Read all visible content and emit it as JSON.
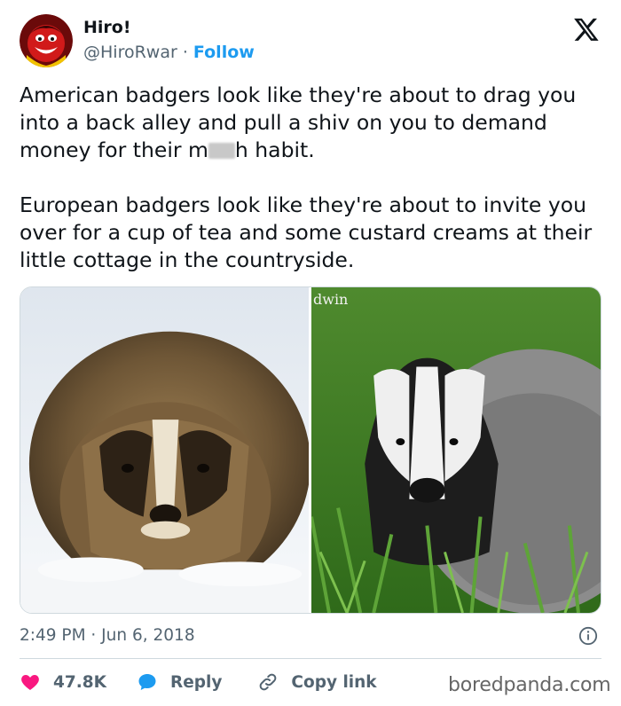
{
  "author": {
    "name": "Hiro!",
    "handle": "@HiroRwar",
    "separator": "·",
    "follow_label": "Follow"
  },
  "tweet": {
    "paragraph1_before": "American badgers look like they're about to drag you into a back alley and pull a shiv on you to demand money for their m",
    "paragraph1_after": "h habit.",
    "paragraph2": "European badgers look like they're about to invite you over for a cup of tea and some custard creams at their little cottage in the countryside.",
    "timestamp": "2:49 PM · Jun 6, 2018"
  },
  "media": {
    "right_watermark": "dwin"
  },
  "actions": {
    "like_count": "47.8K",
    "reply_label": "Reply",
    "copy_link_label": "Copy link"
  },
  "source_watermark": "boredpanda.com",
  "colors": {
    "accent": "#1d9bf0",
    "like": "#f91880",
    "text": "#0f1419",
    "muted": "#536471"
  },
  "icons": {
    "brand": "x-logo-icon",
    "info": "info-icon",
    "like": "heart-icon",
    "reply": "reply-bubble-icon",
    "copy": "link-icon"
  }
}
